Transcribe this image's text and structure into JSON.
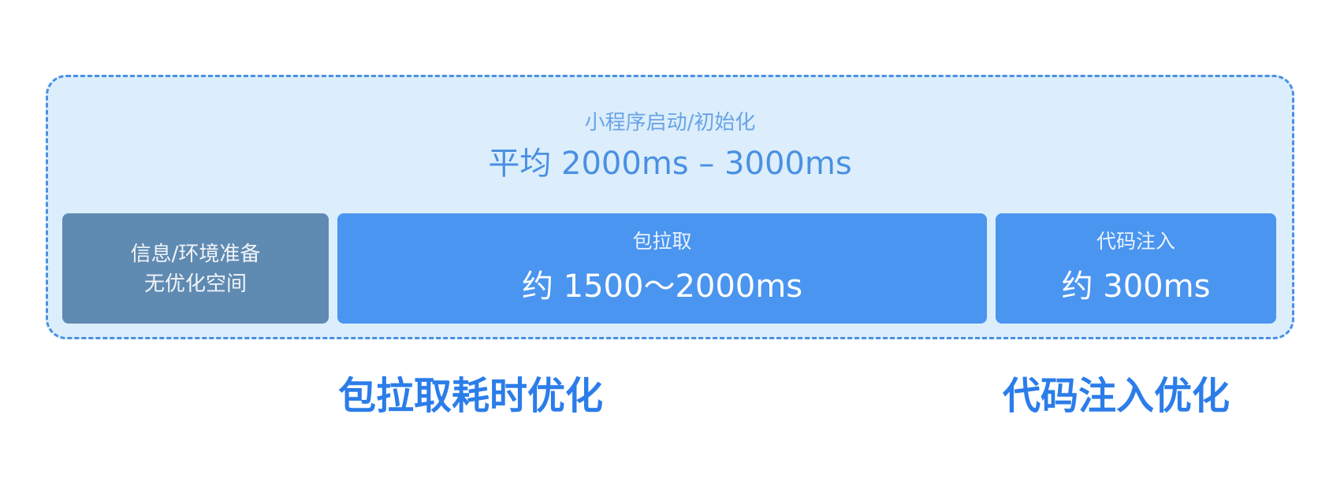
{
  "container": {
    "caption": "小程序启动/初始化",
    "value": "平均 2000ms – 3000ms"
  },
  "blocks": [
    {
      "line1": "信息/环境准备",
      "line2": "无优化空间"
    },
    {
      "title": "包拉取",
      "value": "约 1500～2000ms"
    },
    {
      "title": "代码注入",
      "value": "约 300ms"
    }
  ],
  "labels": {
    "left": "包拉取耗时优化",
    "right": "代码注入优化"
  },
  "colors": {
    "container_border": "#4a90e2",
    "container_fill": "#dceefc",
    "gray_block": "#5f8ab2",
    "blue_block": "#4a95ef",
    "label_text": "#2b7de9"
  }
}
